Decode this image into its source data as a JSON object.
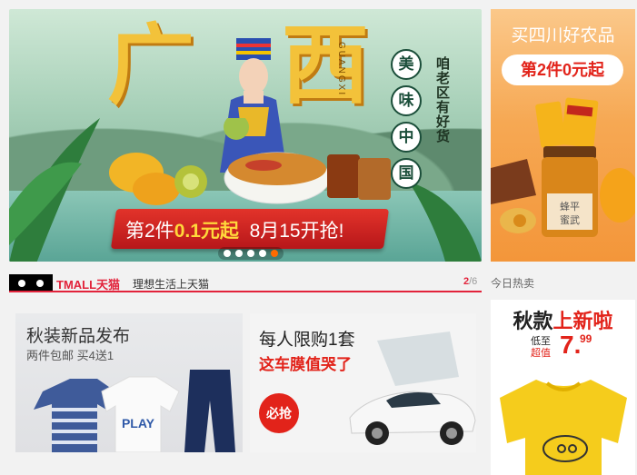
{
  "hero": {
    "big_char_1": "广",
    "big_char_2": "西",
    "pinyin": "GUANGXI",
    "circle_chars": [
      "美",
      "味",
      "中",
      "国"
    ],
    "vertical_text": "咱老区有好货",
    "promo_prefix": "第2件",
    "promo_price": "0.1元起",
    "promo_date": "8月15开抢!",
    "carousel_count": 5,
    "carousel_active": 5
  },
  "side_banner": {
    "title": "买四川好农品",
    "offer": "第2件0元起",
    "jar_label": "蜂平\n蜜武"
  },
  "tmall": {
    "logo_text": "TMALL天猫",
    "slogan": "理想生活上天猫",
    "page_current": "2",
    "page_total": "/6",
    "hot_label": "今日热卖"
  },
  "card_autumn": {
    "title": "秋装新品发布",
    "subtitle": "两件包邮 买4送1",
    "shirt_text": "PLAY"
  },
  "card_film": {
    "title": "每人限购1套",
    "subtitle": "这车膜值哭了",
    "badge": "必抢"
  },
  "card_new": {
    "title_black": "秋款",
    "title_red": "上新啦",
    "low_to": "低至",
    "value": "超值",
    "price": "7.",
    "price_cents": "99"
  },
  "colors": {
    "tmall_red": "#e2233b",
    "promo_red": "#e2231a",
    "accent_orange": "#ff6b00"
  }
}
